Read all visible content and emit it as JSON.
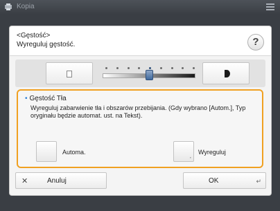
{
  "topbar": {
    "title": "Kopia",
    "app_icon": "copy-app-icon",
    "menu_icon": "hamburger-menu-icon"
  },
  "dialog": {
    "header_line1": "<Gęstość>",
    "header_line2": "Wyreguluj gęstość.",
    "help_label": "?"
  },
  "slider": {
    "steps": 9,
    "current_step": 5,
    "left_icon": "light-density-icon",
    "right_icon": "dark-density-icon"
  },
  "background_density": {
    "title": "Gęstość Tła",
    "description": "Wyreguluj zabarwienie tła i obszarów przebijania. (Gdy wybrano [Autom.], Typ oryginału będzie automat. ust. na Tekst).",
    "auto_label": "Automa.",
    "adjust_label": "Wyreguluj",
    "accent_color": "#f0a020"
  },
  "footer": {
    "cancel_label": "Anuluj",
    "cancel_icon": "close-icon",
    "ok_label": "OK",
    "ok_icon": "enter-icon"
  }
}
